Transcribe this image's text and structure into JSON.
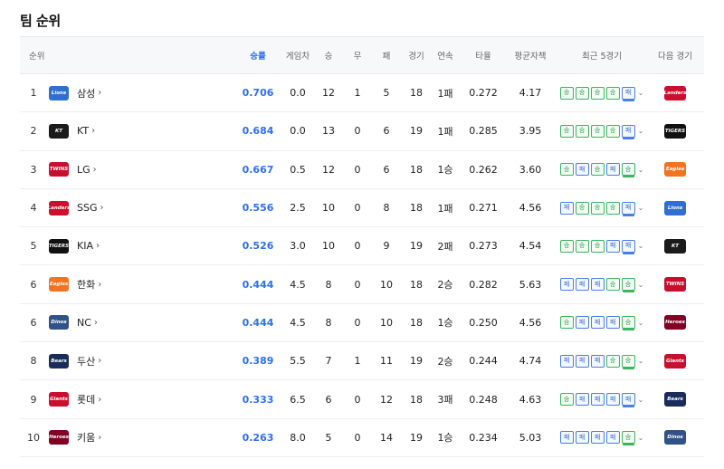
{
  "title": "팀 순위",
  "headers": {
    "rank": "순위",
    "wpct": "승률",
    "gb": "게임차",
    "w": "승",
    "d": "무",
    "l": "패",
    "g": "경기",
    "streak": "연속",
    "avg": "타율",
    "era": "평균자책",
    "recent": "최근 5경기",
    "next": "다음 경기"
  },
  "logos": {
    "samsung": {
      "text": "Lions",
      "color": "#2f6fd1"
    },
    "kt": {
      "text": "KT",
      "color": "#1b1b1b"
    },
    "lg": {
      "text": "TWINS",
      "color": "#c8102e"
    },
    "ssg": {
      "text": "Landers",
      "color": "#ce0e2d"
    },
    "kia": {
      "text": "TIGERS",
      "color": "#111111"
    },
    "hanwha": {
      "text": "Eagles",
      "color": "#f37321"
    },
    "nc": {
      "text": "Dinos",
      "color": "#315288"
    },
    "doosan": {
      "text": "Bears",
      "color": "#1a2c5b"
    },
    "lotte": {
      "text": "Giants",
      "color": "#c8102e"
    },
    "kiwoom": {
      "text": "Heroes",
      "color": "#820024"
    }
  },
  "rows": [
    {
      "rank": "1",
      "logo": "samsung",
      "team": "삼성",
      "wpct": "0.706",
      "gb": "0.0",
      "w": "12",
      "d": "1",
      "l": "5",
      "g": "18",
      "streak": "1패",
      "avg": "0.272",
      "era": "4.17",
      "recent": [
        "승",
        "승",
        "승",
        "승",
        "패"
      ],
      "next": "ssg"
    },
    {
      "rank": "2",
      "logo": "kt",
      "team": "KT",
      "wpct": "0.684",
      "gb": "0.0",
      "w": "13",
      "d": "0",
      "l": "6",
      "g": "19",
      "streak": "1패",
      "avg": "0.285",
      "era": "3.95",
      "recent": [
        "승",
        "승",
        "승",
        "승",
        "패"
      ],
      "next": "kia"
    },
    {
      "rank": "3",
      "logo": "lg",
      "team": "LG",
      "wpct": "0.667",
      "gb": "0.5",
      "w": "12",
      "d": "0",
      "l": "6",
      "g": "18",
      "streak": "1승",
      "avg": "0.262",
      "era": "3.60",
      "recent": [
        "승",
        "패",
        "승",
        "패",
        "승"
      ],
      "next": "hanwha"
    },
    {
      "rank": "4",
      "logo": "ssg",
      "team": "SSG",
      "wpct": "0.556",
      "gb": "2.5",
      "w": "10",
      "d": "0",
      "l": "8",
      "g": "18",
      "streak": "1패",
      "avg": "0.271",
      "era": "4.56",
      "recent": [
        "패",
        "승",
        "승",
        "승",
        "패"
      ],
      "next": "samsung"
    },
    {
      "rank": "5",
      "logo": "kia",
      "team": "KIA",
      "wpct": "0.526",
      "gb": "3.0",
      "w": "10",
      "d": "0",
      "l": "9",
      "g": "19",
      "streak": "2패",
      "avg": "0.273",
      "era": "4.54",
      "recent": [
        "승",
        "승",
        "승",
        "패",
        "패"
      ],
      "next": "kt"
    },
    {
      "rank": "6",
      "logo": "hanwha",
      "team": "한화",
      "wpct": "0.444",
      "gb": "4.5",
      "w": "8",
      "d": "0",
      "l": "10",
      "g": "18",
      "streak": "2승",
      "avg": "0.282",
      "era": "5.63",
      "recent": [
        "패",
        "패",
        "패",
        "승",
        "승"
      ],
      "next": "lg"
    },
    {
      "rank": "6",
      "logo": "nc",
      "team": "NC",
      "wpct": "0.444",
      "gb": "4.5",
      "w": "8",
      "d": "0",
      "l": "10",
      "g": "18",
      "streak": "1승",
      "avg": "0.250",
      "era": "4.56",
      "recent": [
        "승",
        "패",
        "패",
        "패",
        "승"
      ],
      "next": "kiwoom"
    },
    {
      "rank": "8",
      "logo": "doosan",
      "team": "두산",
      "wpct": "0.389",
      "gb": "5.5",
      "w": "7",
      "d": "1",
      "l": "11",
      "g": "19",
      "streak": "2승",
      "avg": "0.244",
      "era": "4.74",
      "recent": [
        "패",
        "패",
        "패",
        "승",
        "승"
      ],
      "next": "lotte"
    },
    {
      "rank": "9",
      "logo": "lotte",
      "team": "롯데",
      "wpct": "0.333",
      "gb": "6.5",
      "w": "6",
      "d": "0",
      "l": "12",
      "g": "18",
      "streak": "3패",
      "avg": "0.248",
      "era": "4.63",
      "recent": [
        "승",
        "패",
        "패",
        "패",
        "패"
      ],
      "next": "doosan"
    },
    {
      "rank": "10",
      "logo": "kiwoom",
      "team": "키움",
      "wpct": "0.263",
      "gb": "8.0",
      "w": "5",
      "d": "0",
      "l": "14",
      "g": "19",
      "streak": "1승",
      "avg": "0.234",
      "era": "5.03",
      "recent": [
        "패",
        "패",
        "패",
        "패",
        "승"
      ],
      "next": "nc"
    }
  ]
}
